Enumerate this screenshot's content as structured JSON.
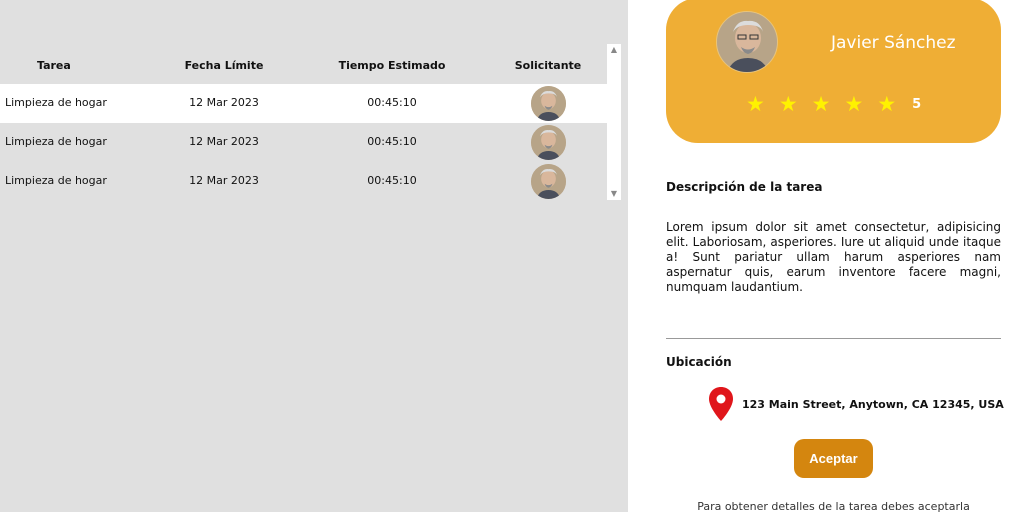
{
  "table": {
    "headers": {
      "task": "Tarea",
      "deadline": "Fecha Límite",
      "estimated": "Tiempo Estimado",
      "requester": "Solicitante"
    },
    "rows": [
      {
        "task": "Limpieza de hogar",
        "deadline": "12 Mar 2023",
        "estimated": "00:45:10",
        "selected": true
      },
      {
        "task": "Limpieza de hogar",
        "deadline": "12 Mar 2023",
        "estimated": "00:45:10",
        "selected": false
      },
      {
        "task": "Limpieza de hogar",
        "deadline": "12 Mar 2023",
        "estimated": "00:45:10",
        "selected": false
      }
    ]
  },
  "profile": {
    "name": "Javier Sánchez",
    "rating": "5",
    "stars": 5,
    "card_color": "#efae35",
    "star_color": "#fff200"
  },
  "description": {
    "title": "Descripción de la tarea",
    "body": "Lorem ipsum dolor sit amet consectetur, adipisicing elit. Laboriosam, asperiores. Iure ut aliquid unde itaque a! Sunt pariatur ullam harum asperiores nam aspernatur quis, earum inventore facere magni, numquam laudantium."
  },
  "location": {
    "title": "Ubicación",
    "address": "123 Main Street, Anytown, CA 12345, USA",
    "icon": "map-pin-icon",
    "pin_color": "#e0161b"
  },
  "actions": {
    "accept_label": "Aceptar",
    "accept_color": "#d4860f",
    "note": "Para obtener detalles de la tarea debes aceptarla"
  }
}
